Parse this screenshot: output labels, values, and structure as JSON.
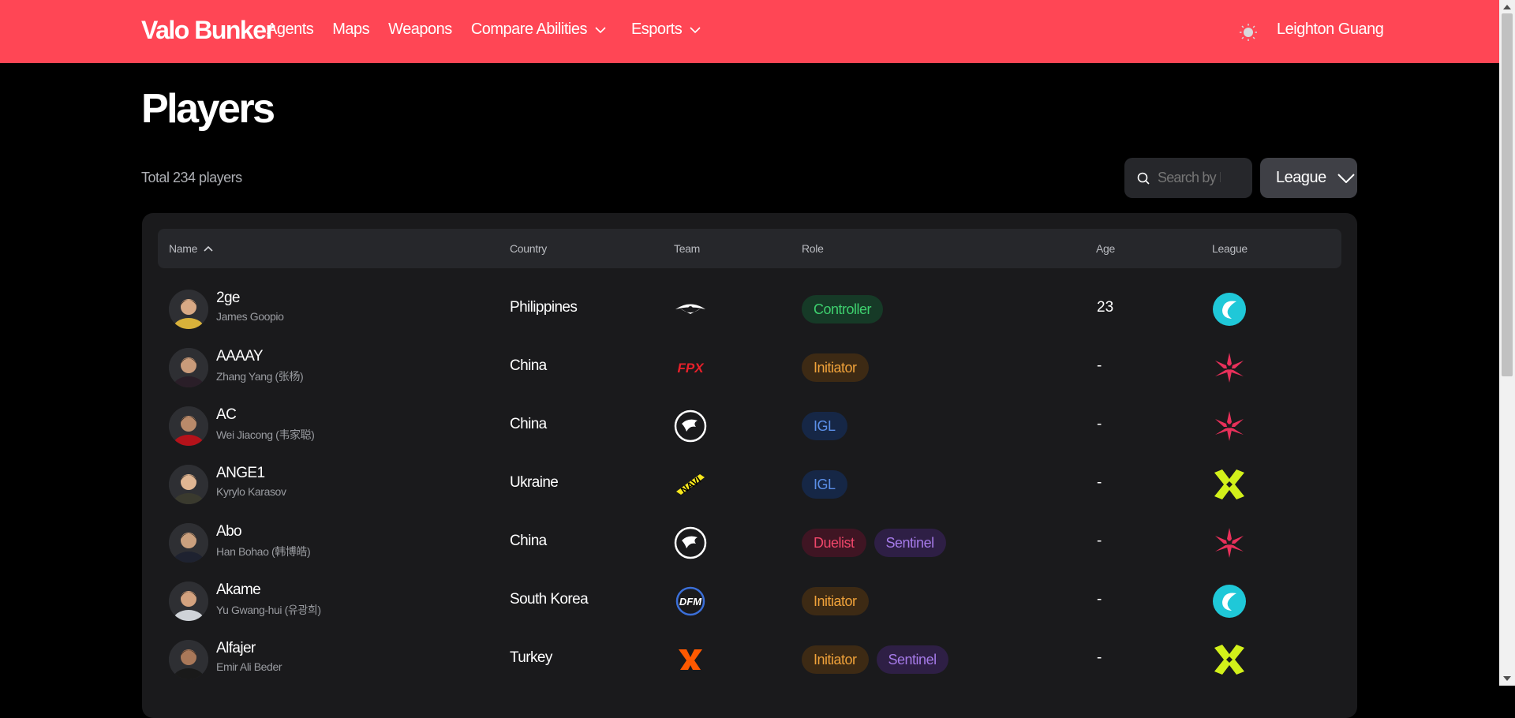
{
  "brand": "Valo Bunker",
  "nav": {
    "agents": "Agents",
    "maps": "Maps",
    "weapons": "Weapons",
    "compare": "Compare Abilities",
    "esports": "Esports"
  },
  "user": "Leighton Guang",
  "page_title": "Players",
  "total": "Total 234 players",
  "search": {
    "placeholder": "Search by IGN"
  },
  "league_filter": "League",
  "columns": {
    "name": "Name",
    "country": "Country",
    "team": "Team",
    "role": "Role",
    "age": "Age",
    "league": "League"
  },
  "players": [
    {
      "ign": "2ge",
      "real": "James Goopio",
      "country": "Philippines",
      "team": "team-secret",
      "roles": [
        "Controller"
      ],
      "age": "23",
      "league": "pacific"
    },
    {
      "ign": "AAAAY",
      "real": "Zhang Yang (张杨)",
      "country": "China",
      "team": "fpx",
      "roles": [
        "Initiator"
      ],
      "age": "-",
      "league": "china"
    },
    {
      "ign": "AC",
      "real": "Wei Jiacong (韦家聪)",
      "country": "China",
      "team": "dragon",
      "roles": [
        "IGL"
      ],
      "age": "-",
      "league": "china"
    },
    {
      "ign": "ANGE1",
      "real": "Kyrylo Karasov",
      "country": "Ukraine",
      "team": "navi",
      "roles": [
        "IGL"
      ],
      "age": "-",
      "league": "emea"
    },
    {
      "ign": "Abo",
      "real": "Han Bohao (韩博皓)",
      "country": "China",
      "team": "dragon",
      "roles": [
        "Duelist",
        "Sentinel"
      ],
      "age": "-",
      "league": "china"
    },
    {
      "ign": "Akame",
      "real": "Yu Gwang-hui (유광희)",
      "country": "South Korea",
      "team": "dfm",
      "roles": [
        "Initiator"
      ],
      "age": "-",
      "league": "pacific"
    },
    {
      "ign": "Alfajer",
      "real": "Emir Ali Beder",
      "country": "Turkey",
      "team": "fnatic",
      "roles": [
        "Initiator",
        "Sentinel"
      ],
      "age": "-",
      "league": "emea"
    }
  ],
  "role_colors": {
    "Controller": {
      "bg": "#163a27",
      "fg": "#3ecf6e"
    },
    "Initiator": {
      "bg": "#3d2a14",
      "fg": "#f0a23a"
    },
    "IGL": {
      "bg": "#162746",
      "fg": "#5b8fe8"
    },
    "Duelist": {
      "bg": "#3f1523",
      "fg": "#f0476a"
    },
    "Sentinel": {
      "bg": "#2e1f45",
      "fg": "#a57ae8"
    }
  },
  "accent": "#ff4655"
}
